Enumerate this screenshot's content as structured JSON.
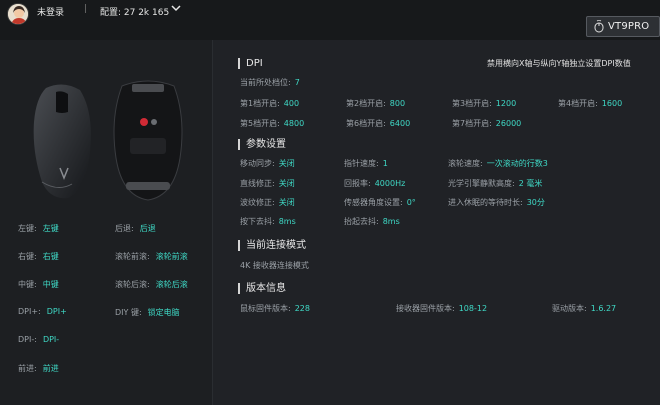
{
  "header": {
    "login_status": "未登录",
    "separator": "|",
    "config_label": "配置: 27 2k 165",
    "model_name": "VT9PRO"
  },
  "buttons": {
    "left": [
      {
        "key": "左键:",
        "value": "左键"
      },
      {
        "key": "右键:",
        "value": "右键"
      },
      {
        "key": "中键:",
        "value": "中键"
      },
      {
        "key": "DPI+:",
        "value": "DPI+"
      },
      {
        "key": "DPI-:",
        "value": "DPI-"
      },
      {
        "key": "前进:",
        "value": "前进"
      }
    ],
    "right": [
      {
        "key": "后退:",
        "value": "后退"
      },
      {
        "key": "滚轮前滚:",
        "value": "滚轮前滚"
      },
      {
        "key": "滚轮后滚:",
        "value": "滚轮后滚"
      },
      {
        "key": "DIY 键:",
        "value": "锁定电脑"
      }
    ]
  },
  "dpi": {
    "title": "DPI",
    "hint": "禁用横向X轴与纵向Y轴独立设置DPI数值",
    "current_label": "当前所处档位:",
    "current_value": "7",
    "levels": [
      {
        "key": "第1档开启:",
        "value": "400"
      },
      {
        "key": "第2档开启:",
        "value": "800"
      },
      {
        "key": "第3档开启:",
        "value": "1200"
      },
      {
        "key": "第4档开启:",
        "value": "1600"
      },
      {
        "key": "第5档开启:",
        "value": "4800"
      },
      {
        "key": "第6档开启:",
        "value": "6400"
      },
      {
        "key": "第7档开启:",
        "value": "26000"
      }
    ]
  },
  "params": {
    "title": "参数设置",
    "items": [
      {
        "key": "移动同步:",
        "value": "关闭"
      },
      {
        "key": "指针速度:",
        "value": "1"
      },
      {
        "key": "滚轮速度:",
        "value": "一次滚动的行数3"
      },
      {
        "key": "直线修正:",
        "value": "关闭"
      },
      {
        "key": "回报率:",
        "value": "4000Hz"
      },
      {
        "key": "光学引擎静默高度:",
        "value": "2 毫米"
      },
      {
        "key": "波纹修正:",
        "value": "关闭"
      },
      {
        "key": "传感器角度设置:",
        "value": "0°"
      },
      {
        "key": "进入休眠的等待时长:",
        "value": "30分"
      },
      {
        "key": "按下去抖:",
        "value": "8ms"
      },
      {
        "key": "抬起去抖:",
        "value": "8ms"
      }
    ]
  },
  "connection": {
    "title": "当前连接模式",
    "mode": "4K 接收器连接模式"
  },
  "version": {
    "title": "版本信息",
    "items": [
      {
        "key": "鼠标固件版本:",
        "value": "228"
      },
      {
        "key": "接收器固件版本:",
        "value": "108-12"
      },
      {
        "key": "驱动版本:",
        "value": "1.6.27"
      }
    ]
  },
  "colors": {
    "accent": "#3fd9c6",
    "background": "#1b1d20",
    "muted_text": "#9aa0a6"
  },
  "icons": [
    "avatar",
    "chevron-down-icon",
    "mouse-icon"
  ]
}
